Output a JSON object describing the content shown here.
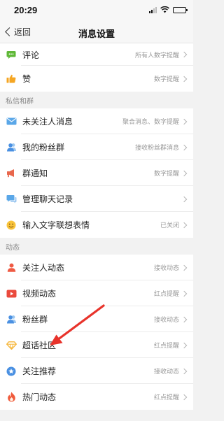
{
  "status": {
    "time": "20:29"
  },
  "nav": {
    "back_label": "返回",
    "title": "消息设置"
  },
  "top_items": [
    {
      "label": "评论",
      "value": "所有人数字提醒"
    },
    {
      "label": "赞",
      "value": "数字提醒"
    }
  ],
  "section_private": {
    "header": "私信和群",
    "items": [
      {
        "label": "未关注人消息",
        "value": "聚合消息、数字提醒"
      },
      {
        "label": "我的粉丝群",
        "value": "接收粉丝群消息"
      },
      {
        "label": "群通知",
        "value": "数字提醒"
      },
      {
        "label": "管理聊天记录",
        "value": ""
      },
      {
        "label": "输入文字联想表情",
        "value": "已关闭"
      }
    ]
  },
  "section_feed": {
    "header": "动态",
    "items": [
      {
        "label": "关注人动态",
        "value": "接收动态"
      },
      {
        "label": "视频动态",
        "value": "红点提醒"
      },
      {
        "label": "粉丝群",
        "value": "接收动态"
      },
      {
        "label": "超话社区",
        "value": "红点提醒"
      },
      {
        "label": "关注推荐",
        "value": "接收动态"
      },
      {
        "label": "热门动态",
        "value": "红点提醒"
      }
    ]
  },
  "colors": {
    "accent_red": "#e8332b",
    "comment_green": "#5fb837",
    "like_orange": "#f5a623",
    "mail_blue": "#5aa7e8",
    "person_blue": "#4a90e2",
    "person_red": "#ef5a43",
    "video_red": "#ea4a3d",
    "diamond_yellow": "#f6b73c",
    "chat_blue": "#5aa7e8",
    "emoji_yellow": "#f8c33a",
    "fire_red": "#f05b3c"
  }
}
